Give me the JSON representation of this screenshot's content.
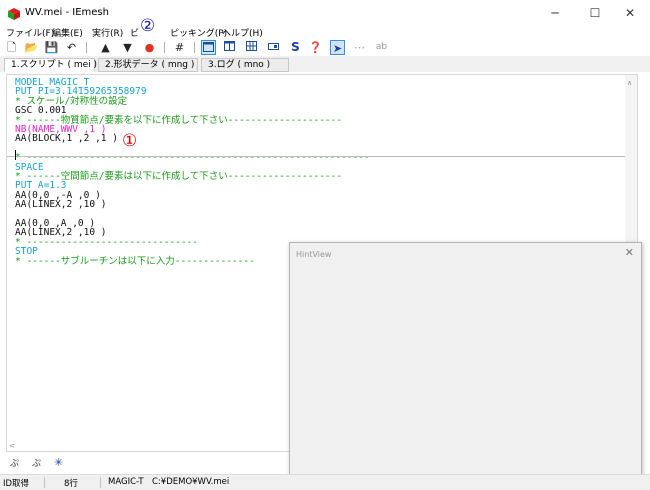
{
  "window": {
    "title": "WV.mei - IEmesh",
    "minimize": "─",
    "maximize": "☐",
    "close": "✕"
  },
  "menu": [
    "ファイル(F)",
    "編集(E)",
    "実行(R)",
    "ビ",
    "ピッキング(P)",
    "ヘルプ(H)"
  ],
  "toolbar_glyphs": {
    "new": "🗋",
    "open": "📂",
    "save": "💾",
    "undo": "↶",
    "up": "▲",
    "down": "▼",
    "run": "●",
    "grid": "#",
    "s": "S",
    "help": "❓",
    "pointer": "➤",
    "net": "⋯",
    "ab": "ab"
  },
  "tabs": [
    "1.スクリプト ( mei )",
    "2.形状データ ( mng )",
    "3.ログ ( mno )"
  ],
  "code": [
    {
      "text": "MODEL MAGIC_T",
      "color": "blue"
    },
    {
      "text": "PUT PI=3.14159265358979",
      "color": "blue"
    },
    {
      "text": "* スケール/対称性の設定",
      "color": "green"
    },
    {
      "text": "GSC 0.001",
      "color": "black"
    },
    {
      "text": "* ------物質節点/要素を以下に作成して下さい--------------------",
      "color": "green"
    },
    {
      "text": "NB(NAME,WWV ,1 )",
      "color": "magenta"
    },
    {
      "text": "AA(BLOCK,1 ,2 ,1 )",
      "color": "black"
    },
    {
      "text": "",
      "color": "black"
    },
    {
      "text": "* ------------------------------------------------------------",
      "color": "green"
    },
    {
      "text": "SPACE",
      "color": "blue"
    },
    {
      "text": "* ------空間節点/要素は以下に作成して下さい--------------------",
      "color": "green"
    },
    {
      "text": "PUT A=1.3",
      "color": "blue"
    },
    {
      "text": "AA(0,0 ,-A ,0 )",
      "color": "black"
    },
    {
      "text": "AA(LINEX,2 ,10 )",
      "color": "black"
    },
    {
      "text": "",
      "color": "black"
    },
    {
      "text": "AA(0,0 ,A ,0 )",
      "color": "black"
    },
    {
      "text": "AA(LINEX,2 ,10 )",
      "color": "black"
    },
    {
      "text": "* ------------------------------",
      "color": "green"
    },
    {
      "text": "STOP",
      "color": "blue"
    },
    {
      "text": "* ------サブルーチンは以下に入力--------------",
      "color": "green"
    }
  ],
  "markers": {
    "one": "①",
    "two": "②"
  },
  "hintview": {
    "title": "HintView",
    "close": "✕"
  },
  "bottom_toolbar": [
    "ぷ",
    "ぷ",
    "✳"
  ],
  "status": [
    "ID取得",
    "8行",
    "MAGIC-T",
    "C:¥DEMO¥WV.mei"
  ],
  "colors": {
    "blue": "#1aa3cc",
    "green": "#1a9a1a",
    "magenta": "#ee22cc",
    "black": "#111111",
    "marker": "#cc0000"
  }
}
